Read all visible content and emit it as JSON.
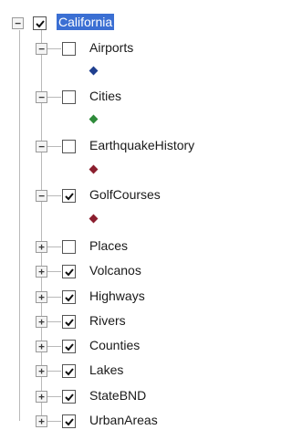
{
  "root": {
    "label": "California",
    "checked": true,
    "expanded": true,
    "selected": true
  },
  "layers": [
    {
      "label": "Airports",
      "checked": false,
      "expanded": true,
      "symbol_color": "#1f3f8f"
    },
    {
      "label": "Cities",
      "checked": false,
      "expanded": true,
      "symbol_color": "#2e8b3a"
    },
    {
      "label": "EarthquakeHistory",
      "checked": false,
      "expanded": true,
      "symbol_color": "#8b1e2e"
    },
    {
      "label": "GolfCourses",
      "checked": true,
      "expanded": true,
      "symbol_color": "#8b1e2e"
    },
    {
      "label": "Places",
      "checked": false,
      "expanded": false
    },
    {
      "label": "Volcanos",
      "checked": true,
      "expanded": false
    },
    {
      "label": "Highways",
      "checked": true,
      "expanded": false
    },
    {
      "label": "Rivers",
      "checked": true,
      "expanded": false
    },
    {
      "label": "Counties",
      "checked": true,
      "expanded": false
    },
    {
      "label": "Lakes",
      "checked": true,
      "expanded": false
    },
    {
      "label": "StateBND",
      "checked": true,
      "expanded": false
    },
    {
      "label": "UrbanAreas",
      "checked": true,
      "expanded": false
    }
  ]
}
